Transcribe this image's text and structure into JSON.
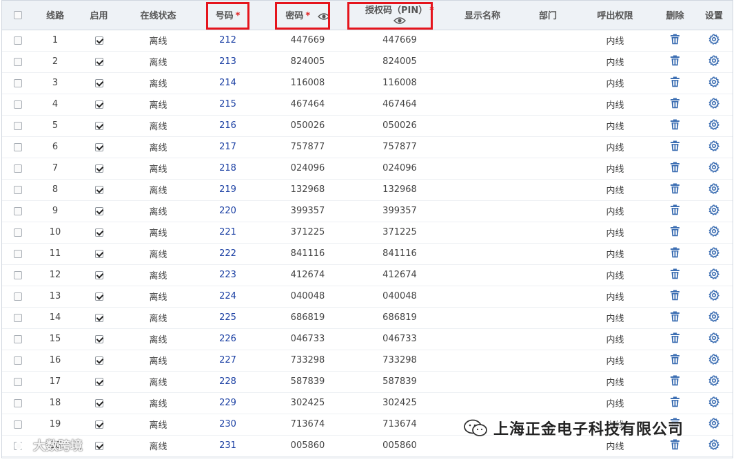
{
  "columns": {
    "select_all": "",
    "line": "线路",
    "enabled": "启用",
    "status": "在线状态",
    "number": "号码",
    "password": "密码",
    "pin": "授权码（PIN）",
    "display_name": "显示名称",
    "department": "部门",
    "call_permission": "呼出权限",
    "delete": "删除",
    "settings": "设置",
    "required_mark": "*"
  },
  "rows": [
    {
      "line": "1",
      "status": "离线",
      "number": "212",
      "password": "447669",
      "pin": "447669",
      "display_name": "",
      "department": "",
      "permission": "内线"
    },
    {
      "line": "2",
      "status": "离线",
      "number": "213",
      "password": "824005",
      "pin": "824005",
      "display_name": "",
      "department": "",
      "permission": "内线"
    },
    {
      "line": "3",
      "status": "离线",
      "number": "214",
      "password": "116008",
      "pin": "116008",
      "display_name": "",
      "department": "",
      "permission": "内线"
    },
    {
      "line": "4",
      "status": "离线",
      "number": "215",
      "password": "467464",
      "pin": "467464",
      "display_name": "",
      "department": "",
      "permission": "内线"
    },
    {
      "line": "5",
      "status": "离线",
      "number": "216",
      "password": "050026",
      "pin": "050026",
      "display_name": "",
      "department": "",
      "permission": "内线"
    },
    {
      "line": "6",
      "status": "离线",
      "number": "217",
      "password": "757877",
      "pin": "757877",
      "display_name": "",
      "department": "",
      "permission": "内线"
    },
    {
      "line": "7",
      "status": "离线",
      "number": "218",
      "password": "024096",
      "pin": "024096",
      "display_name": "",
      "department": "",
      "permission": "内线"
    },
    {
      "line": "8",
      "status": "离线",
      "number": "219",
      "password": "132968",
      "pin": "132968",
      "display_name": "",
      "department": "",
      "permission": "内线"
    },
    {
      "line": "9",
      "status": "离线",
      "number": "220",
      "password": "399357",
      "pin": "399357",
      "display_name": "",
      "department": "",
      "permission": "内线"
    },
    {
      "line": "10",
      "status": "离线",
      "number": "221",
      "password": "371225",
      "pin": "371225",
      "display_name": "",
      "department": "",
      "permission": "内线"
    },
    {
      "line": "11",
      "status": "离线",
      "number": "222",
      "password": "841116",
      "pin": "841116",
      "display_name": "",
      "department": "",
      "permission": "内线"
    },
    {
      "line": "12",
      "status": "离线",
      "number": "223",
      "password": "412674",
      "pin": "412674",
      "display_name": "",
      "department": "",
      "permission": "内线"
    },
    {
      "line": "13",
      "status": "离线",
      "number": "224",
      "password": "040048",
      "pin": "040048",
      "display_name": "",
      "department": "",
      "permission": "内线"
    },
    {
      "line": "14",
      "status": "离线",
      "number": "225",
      "password": "686819",
      "pin": "686819",
      "display_name": "",
      "department": "",
      "permission": "内线"
    },
    {
      "line": "15",
      "status": "离线",
      "number": "226",
      "password": "046733",
      "pin": "046733",
      "display_name": "",
      "department": "",
      "permission": "内线"
    },
    {
      "line": "16",
      "status": "离线",
      "number": "227",
      "password": "733298",
      "pin": "733298",
      "display_name": "",
      "department": "",
      "permission": "内线"
    },
    {
      "line": "17",
      "status": "离线",
      "number": "228",
      "password": "587839",
      "pin": "587839",
      "display_name": "",
      "department": "",
      "permission": "内线"
    },
    {
      "line": "18",
      "status": "离线",
      "number": "229",
      "password": "302425",
      "pin": "302425",
      "display_name": "",
      "department": "",
      "permission": "内线"
    },
    {
      "line": "19",
      "status": "离线",
      "number": "230",
      "password": "713674",
      "pin": "713674",
      "display_name": "",
      "department": "",
      "permission": "内线"
    },
    {
      "line": "20",
      "status": "离线",
      "number": "231",
      "password": "005860",
      "pin": "005860",
      "display_name": "",
      "department": "",
      "permission": "内线"
    }
  ],
  "watermarks": {
    "left": "大数跨境",
    "right": "上海正金电子科技有限公司"
  },
  "colors": {
    "header_bg": "#eef2f6",
    "link_number": "#1a3fa3",
    "required": "#e02020",
    "highlight_box": "#e5141c",
    "icon_blue": "#3d6fb3"
  },
  "icons": {
    "password_toggle": "eye-icon",
    "pin_toggle": "eye-icon",
    "delete": "trash-icon",
    "settings": "gear-icon"
  }
}
